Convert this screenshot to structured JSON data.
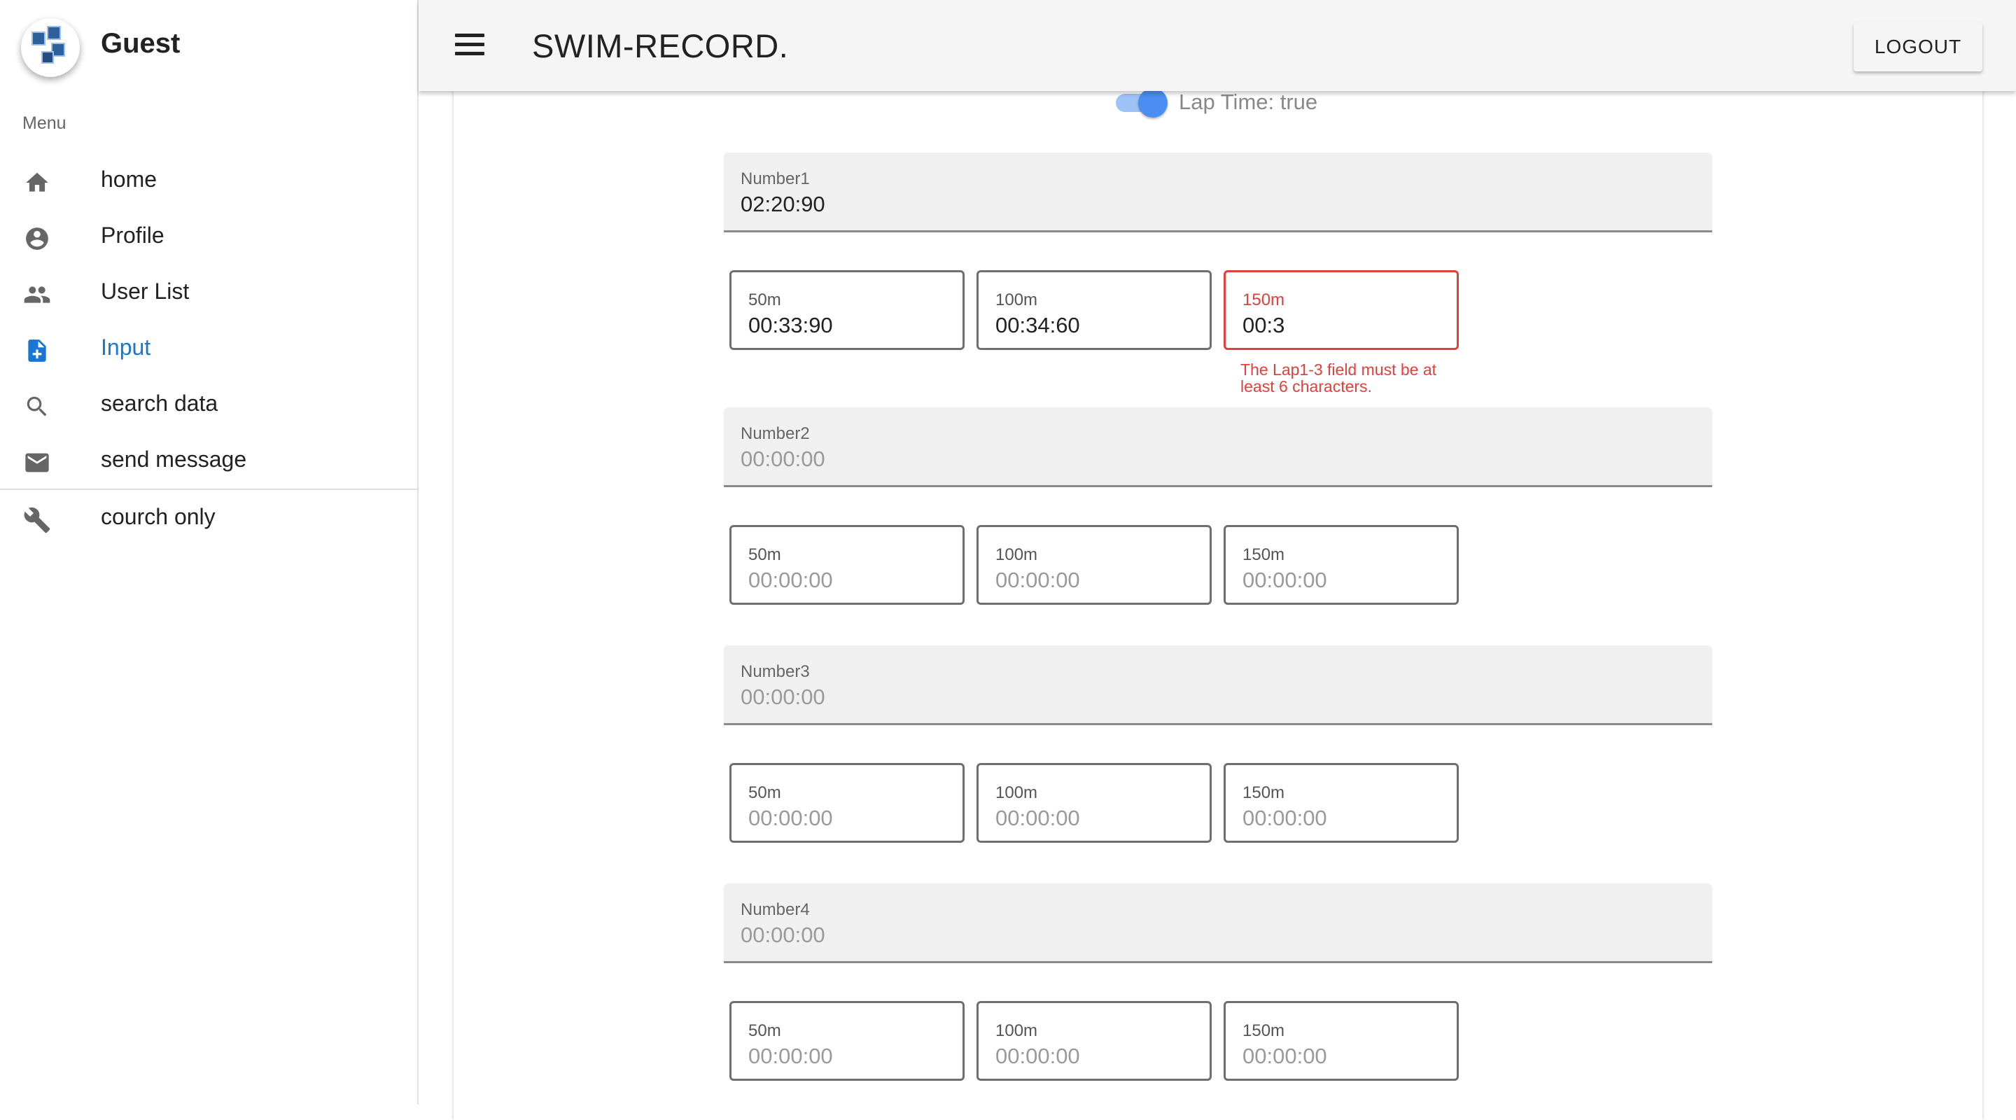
{
  "sidebar": {
    "user_name": "Guest",
    "menu_label": "Menu",
    "items": [
      {
        "label": "home",
        "icon": "home-icon"
      },
      {
        "label": "Profile",
        "icon": "account-circle-icon"
      },
      {
        "label": "User List",
        "icon": "people-icon"
      },
      {
        "label": "Input",
        "icon": "note-add-icon",
        "active": true
      },
      {
        "label": "search data",
        "icon": "search-icon"
      },
      {
        "label": "send message",
        "icon": "mail-icon"
      }
    ],
    "extra_item": {
      "label": "courch only",
      "icon": "wrench-icon"
    }
  },
  "header": {
    "title": "SWIM-RECORD.",
    "logout_label": "LOGOUT"
  },
  "form": {
    "toggle_label": "Lap Time: true",
    "toggle_on": true,
    "records": [
      {
        "label": "Number1",
        "value": "02:20:90",
        "laps": [
          {
            "label": "50m",
            "value": "00:33:90"
          },
          {
            "label": "100m",
            "value": "00:34:60"
          },
          {
            "label": "150m",
            "value": "00:3"
          }
        ],
        "error": "The Lap1-3 field must be at least 6 characters."
      },
      {
        "label": "Number2",
        "placeholder": "00:00:00",
        "laps": [
          {
            "label": "50m",
            "placeholder": "00:00:00"
          },
          {
            "label": "100m",
            "placeholder": "00:00:00"
          },
          {
            "label": "150m",
            "placeholder": "00:00:00"
          }
        ]
      },
      {
        "label": "Number3",
        "placeholder": "00:00:00",
        "laps": [
          {
            "label": "50m",
            "placeholder": "00:00:00"
          },
          {
            "label": "100m",
            "placeholder": "00:00:00"
          },
          {
            "label": "150m",
            "placeholder": "00:00:00"
          }
        ]
      },
      {
        "label": "Number4",
        "placeholder": "00:00:00",
        "laps": [
          {
            "label": "50m",
            "placeholder": "00:00:00"
          },
          {
            "label": "100m",
            "placeholder": "00:00:00"
          },
          {
            "label": "150m",
            "placeholder": "00:00:00"
          }
        ]
      }
    ]
  },
  "colors": {
    "accent": "#1976d2",
    "error": "#e0413c",
    "toggle": "#4b8ef3"
  }
}
